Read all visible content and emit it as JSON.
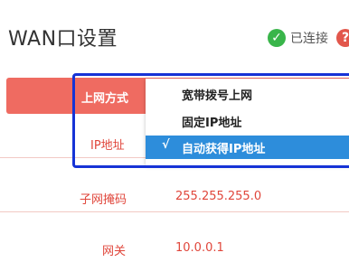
{
  "header": {
    "title": "WAN口设置",
    "status_label": "已连接",
    "status_icon": "check-circle-icon",
    "help_icon": "help-icon",
    "help_glyph": "?"
  },
  "form": {
    "wan_mode_label": "上网方式",
    "ip_label": "IP地址",
    "subnet_label": "子网掩码",
    "subnet_value": "255.255.255.0",
    "gateway_label": "网关",
    "gateway_value": "10.0.0.1"
  },
  "dropdown": {
    "options": [
      {
        "label": "宽带拨号上网",
        "selected": false
      },
      {
        "label": "固定IP地址",
        "selected": false
      },
      {
        "label": "自动获得IP地址",
        "selected": true
      }
    ],
    "selected_mark": "√"
  },
  "colors": {
    "accent_red": "#ef6b61",
    "label_red": "#e0463b",
    "highlight_blue": "#1633d6",
    "selected_blue": "#2d8ddb",
    "status_green": "#39b54a"
  }
}
